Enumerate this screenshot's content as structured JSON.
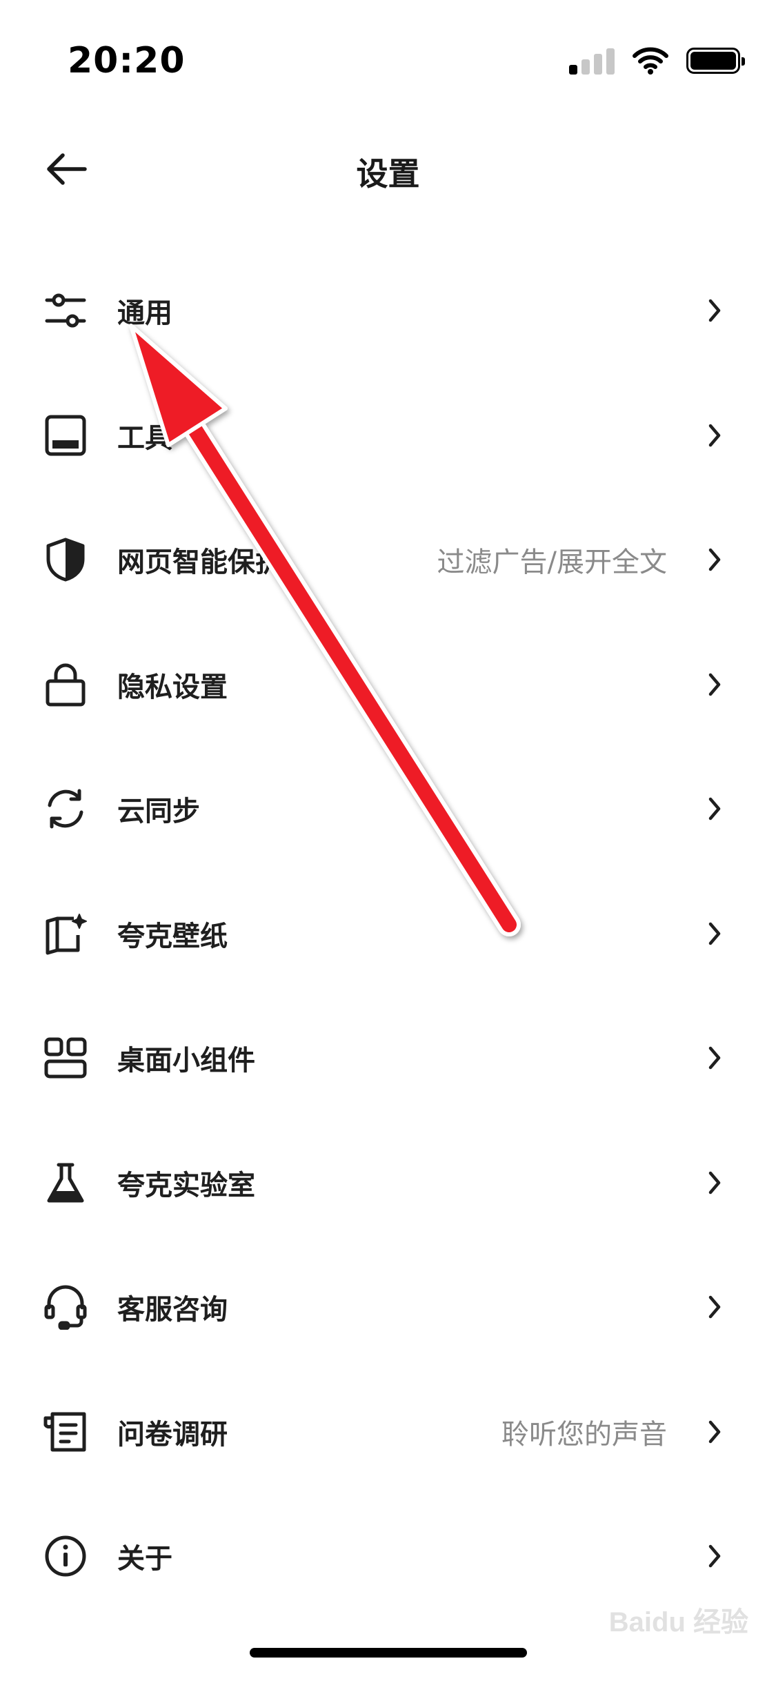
{
  "status_bar": {
    "time": "20:20",
    "signal_bars_on": 1,
    "signal_bars_total": 4,
    "battery_level": 1.0
  },
  "nav": {
    "title": "设置",
    "back_icon": "arrow-left-icon"
  },
  "items": [
    {
      "label": "通用",
      "value": "",
      "icon": "sliders-icon"
    },
    {
      "label": "工具",
      "value": "",
      "icon": "toolbar-icon"
    },
    {
      "label": "网页智能保护",
      "value": "过滤广告/展开全文",
      "icon": "shield-icon"
    },
    {
      "label": "隐私设置",
      "value": "",
      "icon": "lock-icon"
    },
    {
      "label": "云同步",
      "value": "",
      "icon": "sync-icon"
    },
    {
      "label": "夸克壁纸",
      "value": "",
      "icon": "wallpaper-icon"
    },
    {
      "label": "桌面小组件",
      "value": "",
      "icon": "widgets-icon"
    },
    {
      "label": "夸克实验室",
      "value": "",
      "icon": "flask-icon"
    },
    {
      "label": "客服咨询",
      "value": "",
      "icon": "headset-icon"
    },
    {
      "label": "问卷调研",
      "value": "聆听您的声音",
      "icon": "survey-icon"
    },
    {
      "label": "关于",
      "value": "",
      "icon": "info-icon"
    }
  ],
  "watermark": "Baidu 经验",
  "colors": {
    "annotation_arrow": "#ee1c25",
    "text_primary": "#1f1f1f",
    "text_secondary": "#8a8a8a"
  }
}
